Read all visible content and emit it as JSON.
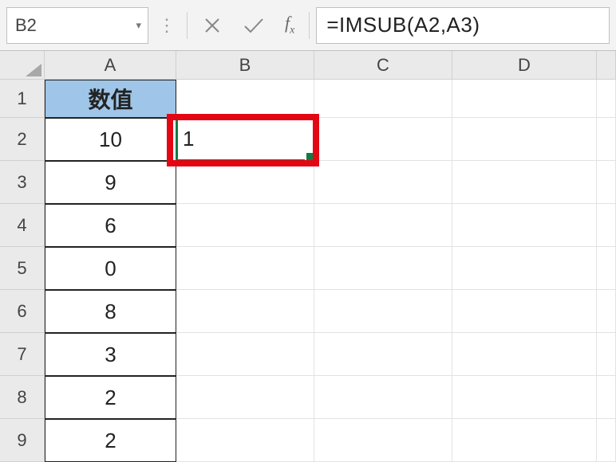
{
  "namebox": {
    "value": "B2"
  },
  "formula_bar": {
    "fx_label": "f",
    "fx_sub": "x",
    "formula": "=IMSUB(A2,A3)"
  },
  "columns": [
    "A",
    "B",
    "C",
    "D",
    ""
  ],
  "rows": [
    "1",
    "2",
    "3",
    "4",
    "5",
    "6",
    "7",
    "8",
    "9"
  ],
  "table": {
    "header": "数值",
    "values": [
      "10",
      "9",
      "6",
      "0",
      "8",
      "3",
      "2",
      "2"
    ]
  },
  "b2_value": "1",
  "icons": {
    "cancel": "×",
    "accept": "✓"
  }
}
